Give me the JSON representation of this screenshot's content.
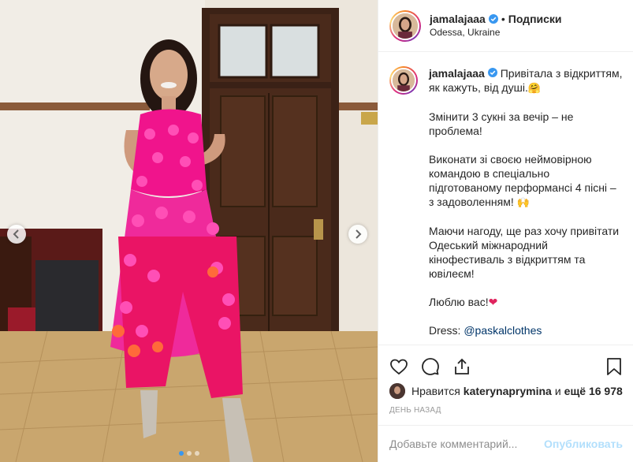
{
  "post": {
    "username": "jamalajaaa",
    "separator": "•",
    "follow_label": "Подписки",
    "location": "Odessa, Ukraine"
  },
  "caption": {
    "username": "jamalajaaa",
    "line1": "Привітала з відкриттям, як кажуть, від душі.",
    "emoji1": "🤗",
    "para2": "Змінити 3 сукні за вечір – не проблема!",
    "para3": "Виконати зі своєю неймовірною командою в спеціально підготованому перформансі 4 пісні – з задоволенням!",
    "emoji3": "🙌",
    "para4": "Маючи нагоду, ще раз хочу привітати Одеський міжнародний кінофестиваль з відкриттям та ювілеєм!",
    "para5": "Люблю вас!",
    "emoji5": "❤",
    "dress_label": "Dress:",
    "dress_mention": "@paskalclothes"
  },
  "likes": {
    "prefix": "Нравится",
    "liker": "katerynaprymina",
    "and_label": "и",
    "count_text": "ещё 16 978"
  },
  "timestamp": "ДЕНЬ НАЗАД",
  "comment_box": {
    "placeholder": "Добавьте комментарий...",
    "publish_label": "Опубликовать"
  },
  "carousel": {
    "slide_count": 3,
    "active_index": 0
  },
  "icons": {
    "like": "heart-outline-icon",
    "comment": "comment-bubble-icon",
    "share": "share-icon",
    "save": "bookmark-icon",
    "verified": "verified-badge-icon",
    "prev": "chevron-left-icon",
    "next": "chevron-right-icon"
  },
  "colors": {
    "verified_blue": "#3897f0",
    "publish_disabled": "#b2dffc",
    "mention": "#003569",
    "dress_pink": "#f0148c"
  }
}
